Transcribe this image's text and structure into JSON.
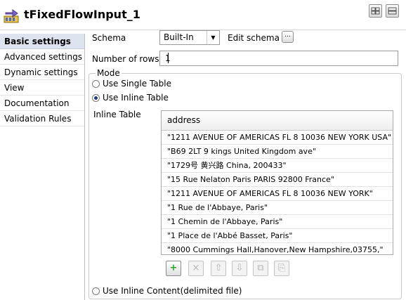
{
  "header": {
    "title": "tFixedFlowInput_1"
  },
  "sidebar": {
    "items": [
      {
        "label": "Basic settings"
      },
      {
        "label": "Advanced settings"
      },
      {
        "label": "Dynamic settings"
      },
      {
        "label": "View"
      },
      {
        "label": "Documentation"
      },
      {
        "label": "Validation Rules"
      }
    ]
  },
  "form": {
    "schema_label": "Schema",
    "schema_value": "Built-In",
    "edit_schema_label": "Edit schema",
    "edit_schema_button": "...",
    "rows_label": "Number of rows",
    "rows_value": "1",
    "mode_label": "Mode",
    "mode_options": [
      "Use Single Table",
      "Use Inline Table",
      "Use Inline Content(delimited file)"
    ],
    "selected_mode": "Use Inline Table",
    "inline_table_label": "Inline Table"
  },
  "table": {
    "column": "address",
    "rows": [
      "\"1211 AVENUE OF  AMERICAS FL 8 10036 NEW YORK USA\"",
      "\"B69 2LT    9 kings        United Kingdom ave\"",
      "\"1729号 黄兴路 China, 200433\"",
      "\"15 Rue Nelaton     Paris PARIS 92800 France\"",
      "\"1211 AVENUE OF  AMERICAS FL 8 10036 NEW YORK\"",
      "\"1 Rue de l'Abbaye,  Paris\"",
      "\"1 Chemin de l'Abbaye,  Paris\"",
      "\"1 Place de l'Abbé Basset,  Paris\"",
      "\"8000 Cummings Hall,Hanover,New Hampshire,03755,\""
    ]
  },
  "toolbar": {
    "add": "+",
    "remove": "×",
    "up": "⇧",
    "down": "⇩",
    "copy": "⧉",
    "paste": "⎘"
  },
  "colors": {
    "add_green": "#2e9e2e",
    "active_tab": "#dde4ef"
  }
}
